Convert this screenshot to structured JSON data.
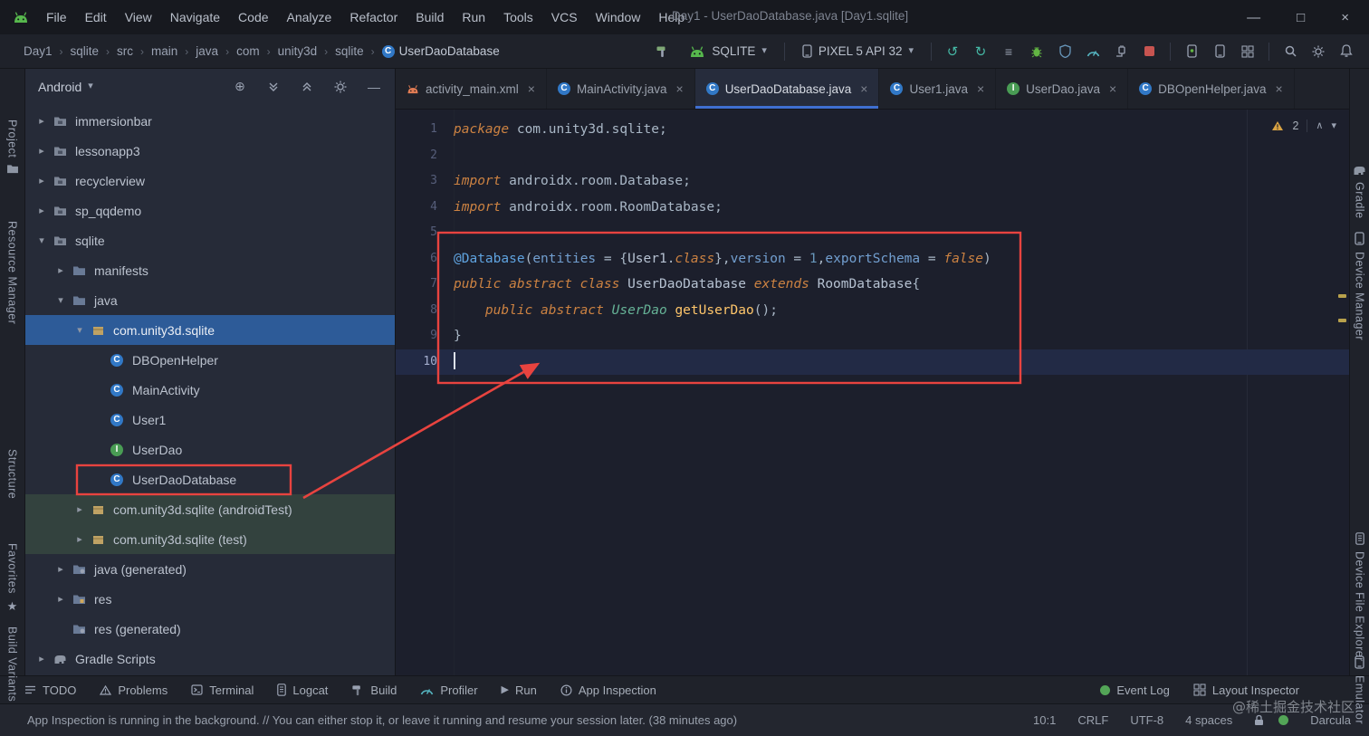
{
  "titlebar": {
    "app_icon": "android-logo-icon",
    "menus": [
      "File",
      "Edit",
      "View",
      "Navigate",
      "Code",
      "Analyze",
      "Refactor",
      "Build",
      "Run",
      "Tools",
      "VCS",
      "Window",
      "Help"
    ],
    "title": "Day1 - UserDaoDatabase.java [Day1.sqlite]",
    "window_controls": [
      "minimize",
      "maximize",
      "close"
    ]
  },
  "toolbar": {
    "breadcrumbs": [
      "Day1",
      "sqlite",
      "src",
      "main",
      "java",
      "com",
      "unity3d",
      "sqlite",
      "UserDaoDatabase"
    ],
    "breadcrumb_leaf_icon": "class-icon",
    "build_icon": "build-project-icon",
    "run_config": {
      "icon": "run-config-android-icon",
      "label": "SQLITE"
    },
    "device": {
      "icon": "device-phone-icon",
      "label": "PIXEL 5 API 32"
    },
    "action_icons": [
      "apply-changes-icon",
      "apply-code-changes-icon",
      "run-configurations-icon",
      "debug-icon",
      "profile-low-overhead-icon",
      "profiler-icon",
      "attach-debugger-icon",
      "stop-icon"
    ],
    "device_icons": [
      "device-manager-icon",
      "pair-devices-icon",
      "layout-validation-icon"
    ],
    "misc_icons": [
      "search-icon",
      "settings-icon",
      "notifications-icon"
    ]
  },
  "stripes": {
    "left": [
      {
        "label": "Project",
        "icon": "project-folder-icon"
      },
      {
        "label": "Resource Manager"
      },
      {
        "label": "Structure"
      },
      {
        "label": "Favorites",
        "icon": "star-icon"
      },
      {
        "label": "Build Variants"
      }
    ],
    "right": [
      {
        "label": "Gradle",
        "icon": "gradle-icon"
      },
      {
        "label": "Device Manager",
        "icon": "device-phone-icon"
      },
      {
        "label": "Device File Explorer",
        "icon": "device-explorer-icon"
      },
      {
        "label": "Emulator",
        "icon": "emulator-icon"
      }
    ]
  },
  "project_panel": {
    "selector": "Android",
    "header_icons": [
      "locate-file-icon",
      "expand-all-icon",
      "collapse-all-icon",
      "settings-icon",
      "hide-panel-icon"
    ],
    "tree": [
      {
        "label": "immersionbar",
        "level": 0,
        "chevron": "right",
        "icon": "module-folder"
      },
      {
        "label": "lessonapp3",
        "level": 0,
        "chevron": "right",
        "icon": "module-folder"
      },
      {
        "label": "recyclerview",
        "level": 0,
        "chevron": "right",
        "icon": "module-folder"
      },
      {
        "label": "sp_qqdemo",
        "level": 0,
        "chevron": "right",
        "icon": "module-folder"
      },
      {
        "label": "sqlite",
        "level": 0,
        "chevron": "down",
        "icon": "module-folder"
      },
      {
        "label": "manifests",
        "level": 1,
        "chevron": "right",
        "icon": "folder"
      },
      {
        "label": "java",
        "level": 1,
        "chevron": "down",
        "icon": "folder"
      },
      {
        "label": "com.unity3d.sqlite",
        "level": 2,
        "chevron": "down",
        "icon": "package",
        "selected": true
      },
      {
        "label": "DBOpenHelper",
        "level": 3,
        "icon": "class"
      },
      {
        "label": "MainActivity",
        "level": 3,
        "icon": "class"
      },
      {
        "label": "User1",
        "level": 3,
        "icon": "class"
      },
      {
        "label": "UserDao",
        "level": 3,
        "icon": "interface"
      },
      {
        "label": "UserDaoDatabase",
        "level": 3,
        "icon": "class",
        "annotated": true
      },
      {
        "label": "com.unity3d.sqlite (androidTest)",
        "level": 2,
        "chevron": "right",
        "icon": "package",
        "highlight": "green"
      },
      {
        "label": "com.unity3d.sqlite (test)",
        "level": 2,
        "chevron": "right",
        "icon": "package",
        "highlight": "green"
      },
      {
        "label": "java (generated)",
        "level": 1,
        "chevron": "right",
        "icon": "folder-generated"
      },
      {
        "label": "res",
        "level": 1,
        "chevron": "right",
        "icon": "folder-res"
      },
      {
        "label": "res (generated)",
        "level": 1,
        "icon": "folder-generated"
      },
      {
        "label": "Gradle Scripts",
        "level": 0,
        "chevron": "right",
        "icon": "gradle"
      }
    ]
  },
  "editor": {
    "tabs": [
      {
        "label": "activity_main.xml",
        "icon": "android-file"
      },
      {
        "label": "MainActivity.java",
        "icon": "class"
      },
      {
        "label": "UserDaoDatabase.java",
        "icon": "class",
        "active": true
      },
      {
        "label": "User1.java",
        "icon": "class"
      },
      {
        "label": "UserDao.java",
        "icon": "interface"
      },
      {
        "label": "DBOpenHelper.java",
        "icon": "class"
      }
    ],
    "inspection_widget": {
      "warnings": "2"
    },
    "code": {
      "current_line": 10,
      "cursor_line": 10,
      "lines": [
        [
          [
            "kw",
            "package "
          ],
          [
            "pl",
            "com.unity3d.sqlite;"
          ]
        ],
        [],
        [
          [
            "kw",
            "import "
          ],
          [
            "pl",
            "androidx.room.Database;"
          ]
        ],
        [
          [
            "kw",
            "import "
          ],
          [
            "pl",
            "androidx.room.RoomDatabase;"
          ]
        ],
        [],
        [
          [
            "ann",
            "@Database"
          ],
          [
            "pl",
            "("
          ],
          [
            "attr",
            "entities"
          ],
          [
            "pl",
            " = {"
          ],
          [
            "cls",
            "User1"
          ],
          [
            "pl",
            "."
          ],
          [
            "kw",
            "class"
          ],
          [
            "pl",
            "},"
          ],
          [
            "attr",
            "version"
          ],
          [
            "pl",
            " = "
          ],
          [
            "num",
            "1"
          ],
          [
            "pl",
            ","
          ],
          [
            "attr",
            "exportSchema"
          ],
          [
            "pl",
            " = "
          ],
          [
            "kw",
            "false"
          ],
          [
            "pl",
            ")"
          ]
        ],
        [
          [
            "kw",
            "public abstract class "
          ],
          [
            "cls",
            "UserDaoDatabase "
          ],
          [
            "kw",
            "extends "
          ],
          [
            "cls",
            "RoomDatabase"
          ],
          [
            "pl",
            "{"
          ]
        ],
        [
          [
            "pl",
            "    "
          ],
          [
            "kw",
            "public abstract "
          ],
          [
            "iface",
            "UserDao"
          ],
          [
            "pl",
            " "
          ],
          [
            "fn",
            "getUserDao"
          ],
          [
            "pl",
            "();"
          ]
        ],
        [
          [
            "pl",
            "}"
          ]
        ],
        []
      ]
    }
  },
  "bottom_bar": {
    "left": [
      {
        "label": "TODO",
        "icon": "todo-icon"
      },
      {
        "label": "Problems",
        "icon": "problems-icon"
      },
      {
        "label": "Terminal",
        "icon": "terminal-icon"
      },
      {
        "label": "Logcat",
        "icon": "logcat-icon"
      },
      {
        "label": "Build",
        "icon": "build-icon"
      },
      {
        "label": "Profiler",
        "icon": "profiler-icon"
      },
      {
        "label": "Run",
        "icon": "run-icon"
      },
      {
        "label": "App Inspection",
        "icon": "app-inspection-icon"
      }
    ],
    "right": [
      {
        "label": "Event Log",
        "icon": "event-log-icon"
      },
      {
        "label": "Layout Inspector",
        "icon": "layout-inspector-icon"
      }
    ]
  },
  "status_bar": {
    "message": "App Inspection is running in the background. // You can either stop it, or leave it running and resume your session later. (38 minutes ago)",
    "caret": "10:1",
    "line_ending": "CRLF",
    "encoding": "UTF-8",
    "indent": "4 spaces",
    "icons": [
      "readonly-lock-icon",
      "status-indicator-icon"
    ],
    "theme": "Darcula"
  },
  "watermark": "@稀土掘金技术社区",
  "annotation_color": "#e8433f"
}
